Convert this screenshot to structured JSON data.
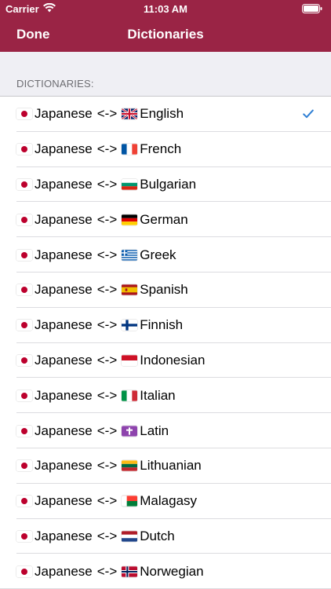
{
  "status_bar": {
    "carrier": "Carrier",
    "time": "11:03 AM",
    "icons": [
      "wifi-icon",
      "battery-icon"
    ]
  },
  "nav": {
    "left_button": "Done",
    "title": "Dictionaries"
  },
  "section": {
    "header": "DICTIONARIES:"
  },
  "source_language": {
    "name": "Japanese",
    "flag": "jp"
  },
  "separator": "<->",
  "accent_color": "#9a2445",
  "check_color": "#2f7fd4",
  "dictionaries": [
    {
      "language": "English",
      "flag": "gb",
      "selected": true
    },
    {
      "language": "French",
      "flag": "fr",
      "selected": false
    },
    {
      "language": "Bulgarian",
      "flag": "bg",
      "selected": false
    },
    {
      "language": "German",
      "flag": "de",
      "selected": false
    },
    {
      "language": "Greek",
      "flag": "gr",
      "selected": false
    },
    {
      "language": "Spanish",
      "flag": "es",
      "selected": false
    },
    {
      "language": "Finnish",
      "flag": "fi",
      "selected": false
    },
    {
      "language": "Indonesian",
      "flag": "id",
      "selected": false
    },
    {
      "language": "Italian",
      "flag": "it",
      "selected": false
    },
    {
      "language": "Latin",
      "flag": "latin-cross",
      "selected": false
    },
    {
      "language": "Lithuanian",
      "flag": "lt",
      "selected": false
    },
    {
      "language": "Malagasy",
      "flag": "mg",
      "selected": false
    },
    {
      "language": "Dutch",
      "flag": "nl",
      "selected": false
    },
    {
      "language": "Norwegian",
      "flag": "no",
      "selected": false
    }
  ]
}
